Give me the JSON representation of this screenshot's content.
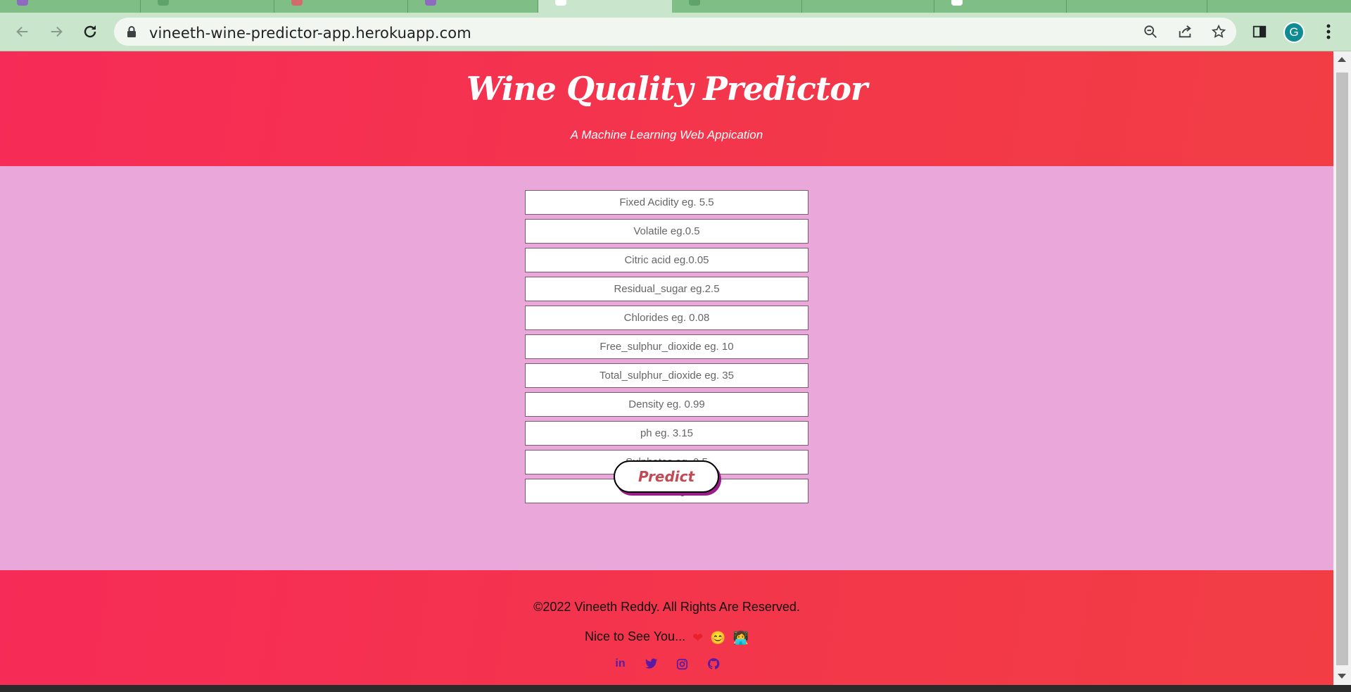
{
  "browser": {
    "url": "vineeth-wine-predictor-app.herokuapp.com",
    "avatar_initial": "G",
    "tab_icon_colors": [
      "#8e6bbf",
      "#5fa36a",
      "#d26b6b",
      "#8e6bbf",
      "#ffffff",
      "#5fa36a",
      "#7fbf85",
      "#ffffff",
      "#7fbf85"
    ]
  },
  "header": {
    "title": "Wine Quality Predictor",
    "subtitle": "A Machine Learning Web Appication"
  },
  "form": {
    "fields": [
      {
        "placeholder": "Fixed Acidity eg. 5.5"
      },
      {
        "placeholder": "Volatile eg.0.5"
      },
      {
        "placeholder": "Citric acid eg.0.05"
      },
      {
        "placeholder": "Residual_sugar eg.2.5"
      },
      {
        "placeholder": "Chlorides eg. 0.08"
      },
      {
        "placeholder": "Free_sulphur_dioxide eg. 10"
      },
      {
        "placeholder": "Total_sulphur_dioxide eg. 35"
      },
      {
        "placeholder": "Density eg. 0.99"
      },
      {
        "placeholder": "ph eg. 3.15"
      },
      {
        "placeholder": "Sulphates eg. 0.5"
      },
      {
        "placeholder": "Alcohol eg. 6"
      }
    ],
    "submit_label": "Predict"
  },
  "footer": {
    "copyright": "©2022 Vineeth Reddy. All Rights Are Reserved.",
    "greeting": "Nice to See You...",
    "emojis": [
      "❤",
      "😊",
      "👩‍💻"
    ],
    "social": [
      {
        "icon": "linkedin-icon",
        "glyph": "in"
      },
      {
        "icon": "twitter-icon"
      },
      {
        "icon": "instagram-icon"
      },
      {
        "icon": "github-icon"
      }
    ]
  },
  "colors": {
    "header_bg": "#f3374a",
    "page_bg": "#eaa8da",
    "button_text": "#c24a55",
    "social_icon": "#5b1aa3"
  }
}
